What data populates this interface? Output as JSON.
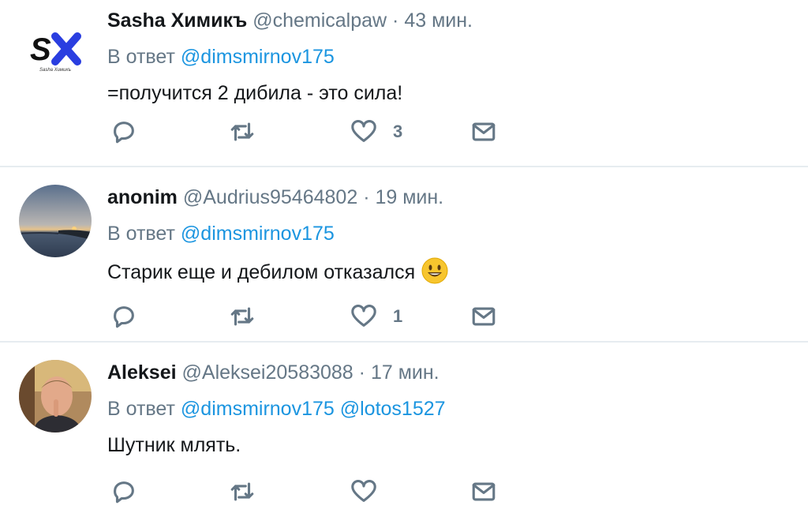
{
  "tweets": [
    {
      "name": "Sasha Химикъ",
      "handle": "@chemicalpaw",
      "dot": "·",
      "time": "43 мин.",
      "reply_prefix": "В ответ",
      "mentions": [
        "@dimsmirnov175"
      ],
      "text": "=получится 2 дибила - это сила!",
      "like_count": "3",
      "avatar_logo": "SX",
      "avatar_logo_sub": "Sasha Химикъ"
    },
    {
      "name": "anonim",
      "handle": "@Audrius95464802",
      "dot": "·",
      "time": "19 мин.",
      "reply_prefix": "В ответ",
      "mentions": [
        "@dimsmirnov175"
      ],
      "text": "Старик еще и дебилом отказался",
      "like_count": "1",
      "emoji": "smiley-face-icon"
    },
    {
      "name": "Aleksei",
      "handle": "@Aleksei20583088",
      "dot": "·",
      "time": "17 мин.",
      "reply_prefix": "В ответ",
      "mentions": [
        "@dimsmirnov175",
        "@lotos1527"
      ],
      "text": "Шутник млять.",
      "like_count": ""
    }
  ],
  "icons": {
    "reply": "reply-icon",
    "retweet": "retweet-icon",
    "like": "heart-icon",
    "dm": "envelope-icon"
  },
  "colors": {
    "mention": "#1b95e0",
    "secondary": "#657786",
    "divider": "#e6ecf0"
  }
}
